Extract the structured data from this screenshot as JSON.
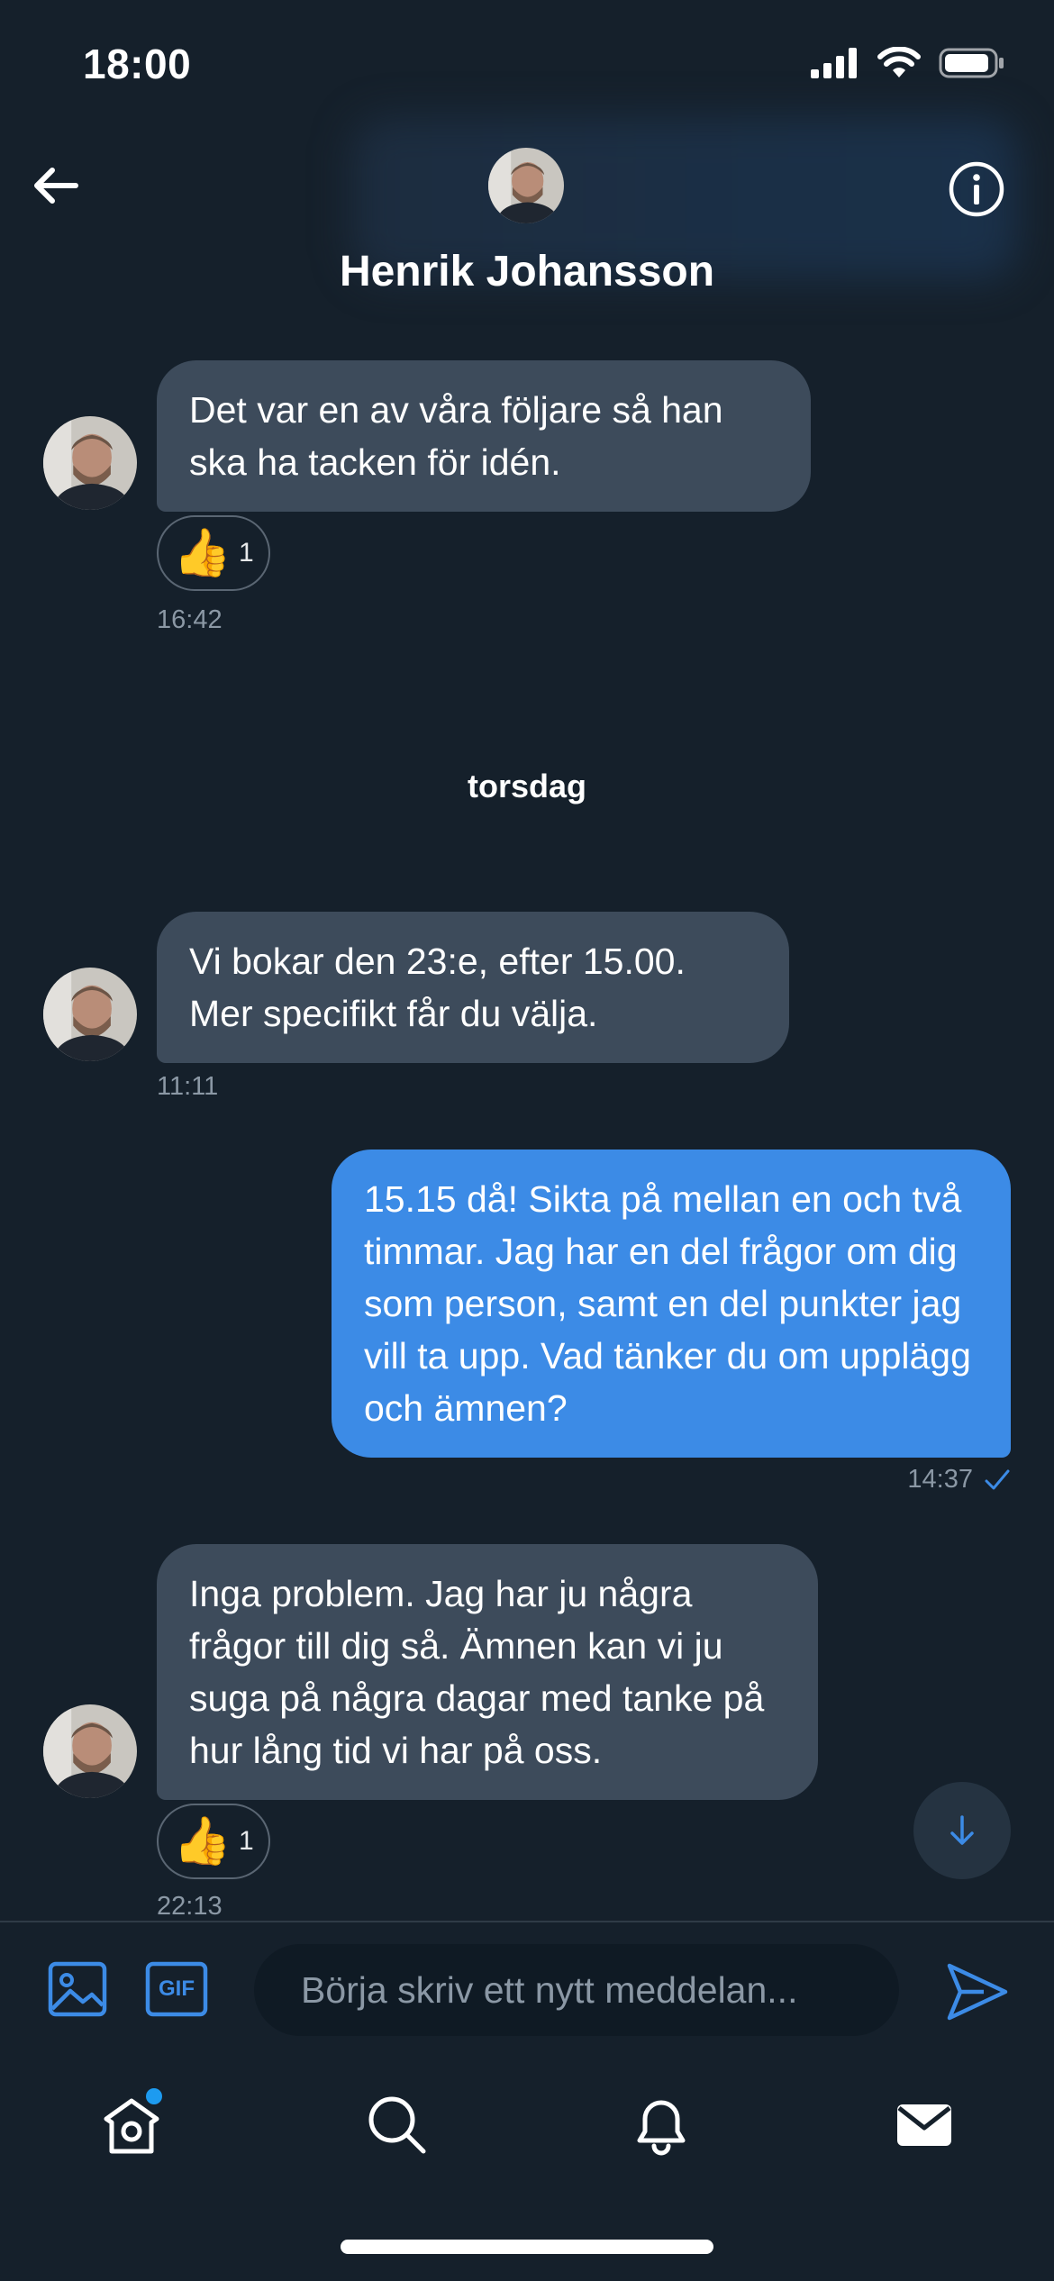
{
  "status_bar": {
    "time": "18:00"
  },
  "header": {
    "name": "Henrik Johansson",
    "avatar": "contact-avatar-photo"
  },
  "messages": [
    {
      "direction": "in",
      "text": "Det var en av våra följare så han ska ha tacken för idén.",
      "reaction": {
        "emoji": "👍",
        "count": "1"
      },
      "time": "16:42"
    },
    {
      "direction": "in",
      "text": "Vi bokar den 23:e, efter 15.00. Mer specifikt får du välja.",
      "time": "11:11"
    },
    {
      "direction": "out",
      "text": "15.15 då! Sikta på mellan en och två timmar. Jag har en del frågor om dig som person, samt en del punkter jag vill ta upp. Vad tänker du om upplägg och ämnen?",
      "time": "14:37",
      "status_icon": "checkmark-icon"
    },
    {
      "direction": "in",
      "text": "Inga problem. Jag har ju några frågor till dig så. Ämnen kan vi ju suga på några dagar med tanke på hur lång tid vi har på oss.",
      "reaction": {
        "emoji": "👍",
        "count": "1"
      },
      "time": "22:13"
    }
  ],
  "day_separator": "torsdag",
  "composer": {
    "placeholder": "Börja skriv ett nytt meddelan...",
    "gif_label": "GIF"
  },
  "tab_bar": {
    "items": [
      "home-icon",
      "search-icon",
      "notifications-icon",
      "messages-icon"
    ],
    "home_has_badge": true
  },
  "colors": {
    "background": "#15202b",
    "incoming_bubble": "#3d4b5b",
    "outgoing_bubble": "#3c8be6",
    "accent": "#1d9bf0"
  }
}
